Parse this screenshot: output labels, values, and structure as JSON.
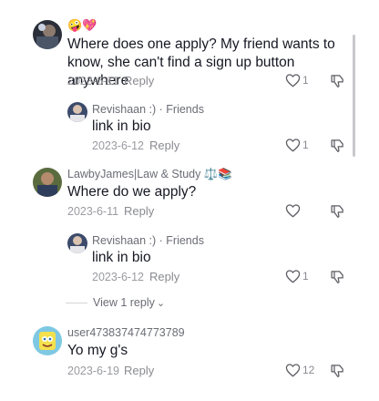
{
  "comments": [
    {
      "username": "",
      "username_emoji": "🤪💖",
      "text": "Where does one apply? My friend wants to know, she can't find a sign up button anywhere",
      "date": "2023-6-11",
      "reply_label": "Reply",
      "likes": "1"
    },
    {
      "username": "Revishaan :) · Friends",
      "text": "link in bio",
      "date": "2023-6-12",
      "reply_label": "Reply",
      "likes": "1"
    },
    {
      "username": "LawbyJames|Law & Study ⚖️📚",
      "text": "Where do we apply?",
      "date": "2023-6-11",
      "reply_label": "Reply",
      "likes": ""
    },
    {
      "username": "Revishaan :) · Friends",
      "text": "link in bio",
      "date": "2023-6-12",
      "reply_label": "Reply",
      "likes": "1"
    },
    {
      "username": "user473837474773789",
      "text": "Yo my g's",
      "date": "2023-6-19",
      "reply_label": "Reply",
      "likes": "12"
    }
  ],
  "view_replies": {
    "label": "View 1 reply",
    "chevron": "⌄"
  },
  "icons": {
    "like": "heart-outline-icon",
    "dislike": "thumbs-down-icon"
  },
  "colors": {
    "text": "#161823",
    "muted": "#8a8b91",
    "scrollbar": "#c8c8cc"
  }
}
